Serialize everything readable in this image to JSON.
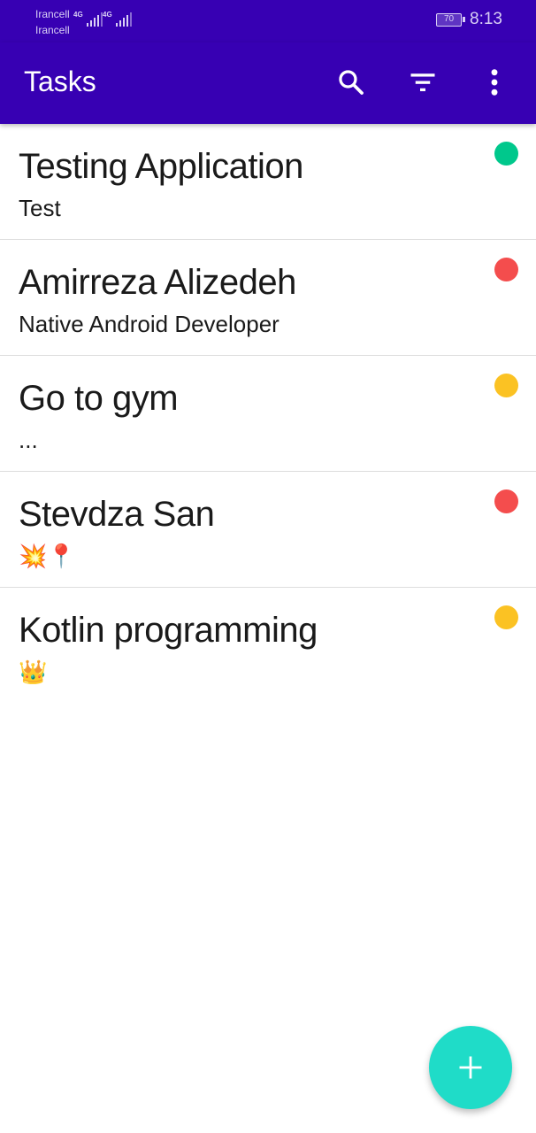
{
  "status_bar": {
    "carrier_1": "Irancell",
    "carrier_2": "Irancell",
    "network_1": "4G",
    "network_2": "4G",
    "battery": "70",
    "time": "8:13"
  },
  "app_bar": {
    "title": "Tasks",
    "icons": [
      "search-icon",
      "filter-icon",
      "more-vert-icon"
    ]
  },
  "tasks": [
    {
      "title": "Testing Application",
      "description": "Test",
      "priority_color": "#00c88c"
    },
    {
      "title": "Amirreza Alizedeh",
      "description": "Native Android Developer",
      "priority_color": "#f44d4d"
    },
    {
      "title": "Go to gym",
      "description": "...",
      "priority_color": "#fbc223"
    },
    {
      "title": "Stevdza San",
      "description": "💥📍",
      "priority_color": "#f44d4d"
    },
    {
      "title": "Kotlin programming",
      "description": "👑",
      "priority_color": "#fbc223"
    }
  ],
  "fab": {
    "icon": "add-icon"
  },
  "colors": {
    "primary": "#3700b3",
    "fab": "#1fdcc8",
    "divider": "#dddddd"
  }
}
